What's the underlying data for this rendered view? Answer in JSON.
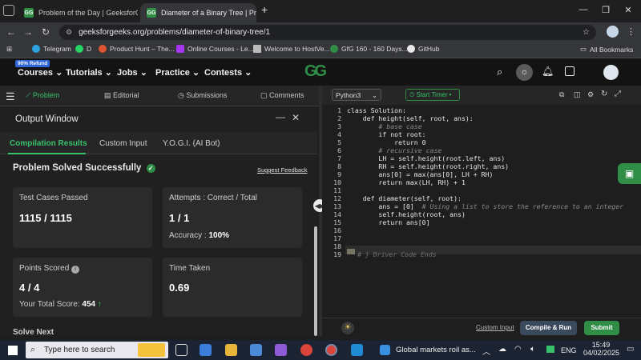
{
  "browser": {
    "tabs": [
      {
        "title": "Problem of the Day | GeeksforG",
        "active": false
      },
      {
        "title": "Diameter of a Binary Tree | Prac",
        "active": true
      }
    ],
    "new_tab_symbol": "+",
    "url": "geeksforgeeks.org/problems/diameter-of-binary-tree/1",
    "bookmarks": [
      {
        "label": "Telegram",
        "color": "#2aa3df"
      },
      {
        "label": "D",
        "color": "#25d366"
      },
      {
        "label": "Product Hunt – The...",
        "color": "#da552f"
      },
      {
        "label": "Online Courses - Le...",
        "color": "#a435f0"
      },
      {
        "label": "Welcome to HostVe...",
        "color": "#bbbbbb"
      },
      {
        "label": "GfG 160 - 160 Days...",
        "color": "#2f8d46"
      },
      {
        "label": "GitHub",
        "color": "#e8e8e8"
      }
    ],
    "all_bookmarks": "All Bookmarks"
  },
  "gfg": {
    "logo": "GG",
    "refund_badge": "90% Refund",
    "nav": [
      "Courses",
      "Tutorials",
      "Jobs",
      "Practice",
      "Contests"
    ]
  },
  "problem_tabs": [
    "Problem",
    "Editorial",
    "Submissions",
    "Comments"
  ],
  "output": {
    "title": "Output Window",
    "tabs": [
      "Compilation Results",
      "Custom Input",
      "Y.O.G.I. (AI Bot)"
    ],
    "status": "Problem Solved Successfully",
    "suggest_feedback": "Suggest Feedback",
    "test_cases_label": "Test Cases Passed",
    "test_cases_value": "1115 / 1115",
    "attempts_label": "Attempts : Correct / Total",
    "attempts_value": "1 / 1",
    "accuracy_label": "Accuracy :",
    "accuracy_value": "100%",
    "points_label": "Points Scored",
    "points_value": "4 / 4",
    "total_score_label": "Your Total Score:",
    "total_score_value": "454",
    "time_label": "Time Taken",
    "time_value": "0.69",
    "solve_next": "Solve Next"
  },
  "editor": {
    "language": "Python3",
    "start_timer": "Start Timer",
    "lines": [
      {
        "n": "1",
        "text": "class Solution:"
      },
      {
        "n": "2",
        "text": "    def height(self, root, ans):"
      },
      {
        "n": "3",
        "text": "        # base case"
      },
      {
        "n": "4",
        "text": "        if not root:"
      },
      {
        "n": "5",
        "text": "            return 0"
      },
      {
        "n": "6",
        "text": "        # recursive case"
      },
      {
        "n": "7",
        "text": "        LH = self.height(root.left, ans)"
      },
      {
        "n": "8",
        "text": "        RH = self.height(root.right, ans)"
      },
      {
        "n": "9",
        "text": "        ans[0] = max(ans[0], LH + RH)"
      },
      {
        "n": "10",
        "text": "        return max(LH, RH) + 1"
      },
      {
        "n": "11",
        "text": ""
      },
      {
        "n": "12",
        "text": "    def diameter(self, root):"
      },
      {
        "n": "13",
        "text": "        ans = [0]  # Using a list to store the reference to an integer"
      },
      {
        "n": "14",
        "text": "        self.height(root, ans)"
      },
      {
        "n": "15",
        "text": "        return ans[0]"
      },
      {
        "n": "16",
        "text": ""
      },
      {
        "n": "17",
        "text": ""
      },
      {
        "n": "18",
        "text": ""
      },
      {
        "n": "19",
        "text": "# } Driver Code Ends"
      }
    ],
    "custom_input": "Custom Input",
    "compile_run": "Compile & Run",
    "submit": "Submit"
  },
  "taskbar": {
    "search_placeholder": "Type here to search",
    "news": "Global markets roil as...",
    "lang": "ENG",
    "time": "15:49",
    "date": "04/02/2025"
  },
  "colors": {
    "gfg_green": "#2f8d46",
    "submit_green": "#2f8d46",
    "compile_btn": "#3a4a5c"
  }
}
